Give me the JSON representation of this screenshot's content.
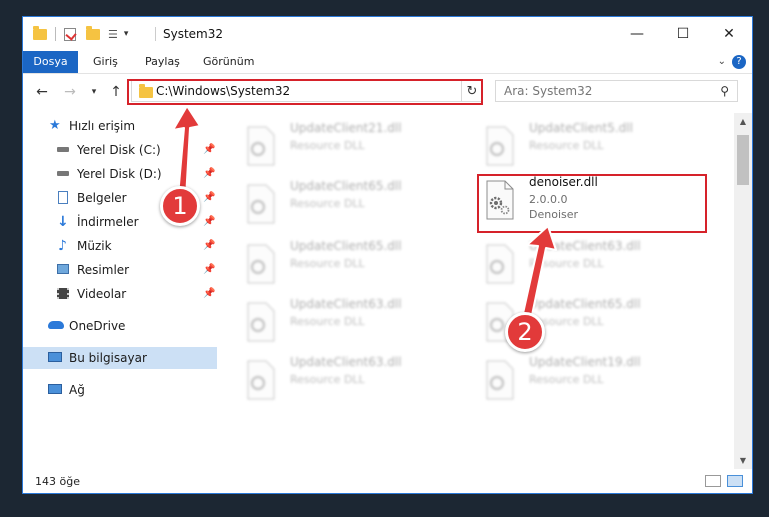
{
  "window": {
    "title": "System32",
    "controls": {
      "minimize": "—",
      "maximize": "☐",
      "close": "✕"
    }
  },
  "ribbon": {
    "tabs": [
      "Dosya",
      "Giriş",
      "Paylaş",
      "Görünüm"
    ],
    "help": "?"
  },
  "nav": {
    "address": "C:\\Windows\\System32",
    "search_placeholder": "Ara: System32"
  },
  "sidebar": {
    "quick_access": "Hızlı erişim",
    "items": [
      {
        "label": "Yerel Disk (C:)",
        "icon": "drive-icon",
        "pinned": true
      },
      {
        "label": "Yerel Disk (D:)",
        "icon": "drive-icon",
        "pinned": true
      },
      {
        "label": "Belgeler",
        "icon": "documents-icon",
        "pinned": true
      },
      {
        "label": "İndirmeler",
        "icon": "downloads-icon",
        "pinned": true
      },
      {
        "label": "Müzik",
        "icon": "music-icon",
        "pinned": true
      },
      {
        "label": "Resimler",
        "icon": "pictures-icon",
        "pinned": true
      },
      {
        "label": "Videolar",
        "icon": "videos-icon",
        "pinned": true
      }
    ],
    "onedrive": "OneDrive",
    "this_pc": "Bu bilgisayar",
    "network": "Ağ"
  },
  "files": [
    {
      "name": "UpdateClient21.dll",
      "desc": "Resource DLL",
      "blurred": true
    },
    {
      "name": "UpdateClient5.dll",
      "desc": "Resource DLL",
      "blurred": true
    },
    {
      "name": "UpdateClient65.dll",
      "desc": "Resource DLL",
      "blurred": true
    },
    {
      "name": "denoiser.dll",
      "desc": "2.0.0.0",
      "desc2": "Denoiser",
      "blurred": false
    },
    {
      "name": "UpdateClient65.dll",
      "desc": "Resource DLL",
      "blurred": true
    },
    {
      "name": "UpdateClient63.dll",
      "desc": "Resource DLL",
      "blurred": true
    },
    {
      "name": "UpdateClient63.dll",
      "desc": "Resource DLL",
      "blurred": true
    },
    {
      "name": "UpdateClient65.dll",
      "desc": "Resource DLL",
      "blurred": true
    },
    {
      "name": "UpdateClient63.dll",
      "desc": "Resource DLL",
      "blurred": true
    },
    {
      "name": "UpdateClient19.dll",
      "desc": "Resource DLL",
      "blurred": true
    }
  ],
  "status": {
    "count": "143 öğe"
  },
  "annotations": {
    "marker1": "1",
    "marker2": "2",
    "color": "#e23a3a",
    "box_color": "#d6222a"
  },
  "colors": {
    "accent": "#1b66c4",
    "selection": "#cce0f5"
  }
}
